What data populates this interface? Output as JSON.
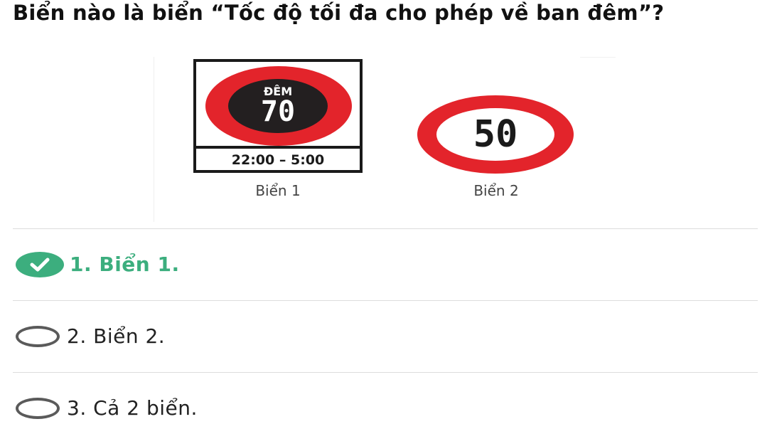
{
  "question": "Biển nào là biển “Tốc độ tối đa cho phép về ban đêm”?",
  "figure": {
    "sign1": {
      "top_text": "ĐÊM",
      "speed": "70",
      "time": "22:00 – 5:00",
      "caption": "Biển 1"
    },
    "sign2": {
      "speed": "50",
      "caption": "Biển 2"
    }
  },
  "options": [
    {
      "label": "1. Biển 1.",
      "state": "correct",
      "icon": "check-circle-icon"
    },
    {
      "label": "2. Biển 2.",
      "state": "unselected",
      "icon": "radio-empty-icon"
    },
    {
      "label": "3. Cả 2 biển.",
      "state": "unselected",
      "icon": "radio-empty-icon"
    }
  ],
  "colors": {
    "correct": "#3cae7e",
    "sign_red": "#e3242b",
    "radio_border": "#5a5a5a"
  }
}
